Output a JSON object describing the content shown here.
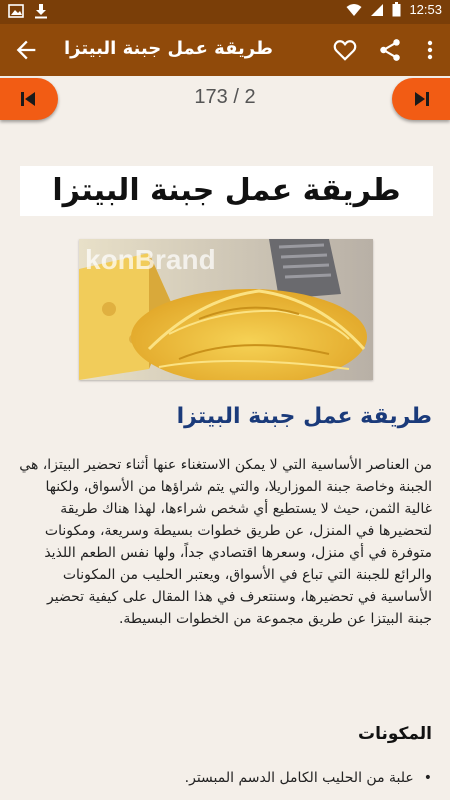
{
  "status_bar": {
    "time": "12:53"
  },
  "app_bar": {
    "title": "طريقة عمل جبنة البيتزا"
  },
  "pager": {
    "counter": "173 / 2"
  },
  "article": {
    "headline": "طريقة عمل جبنة البيتزا",
    "image_watermark": "konBrand",
    "subheading": "طريقة عمل جبنة البيتزا",
    "paragraph": "من العناصر الأساسية التي لا يمكن الاستغناء عنها أثناء تحضير البيتزا، هي الجبنة وخاصة جبنة الموزاريلا، والتي يتم شراؤها من الأسواق، ولكنها غالية الثمن، حيث لا يستطيع أي شخص شراءها، لهذا هناك طريقة لتحضيرها في المنزل، عن طريق خطوات بسيطة وسريعة، ومكونات متوفرة في أي منزل، وسعرها اقتصادي جداً، ولها نفس الطعم اللذيذ والرائع للجبنة التي تباع في الأسواق، ويعتبر الحليب من المكونات الأساسية في تحضيرها، وسنتعرف في هذا المقال على كيفية تحضير جبنة البيتزا عن طريق مجموعة من الخطوات البسيطة.",
    "section_title": "المكونات",
    "ingredients": [
      "علبة من الحليب الكامل الدسم المبستر."
    ]
  }
}
